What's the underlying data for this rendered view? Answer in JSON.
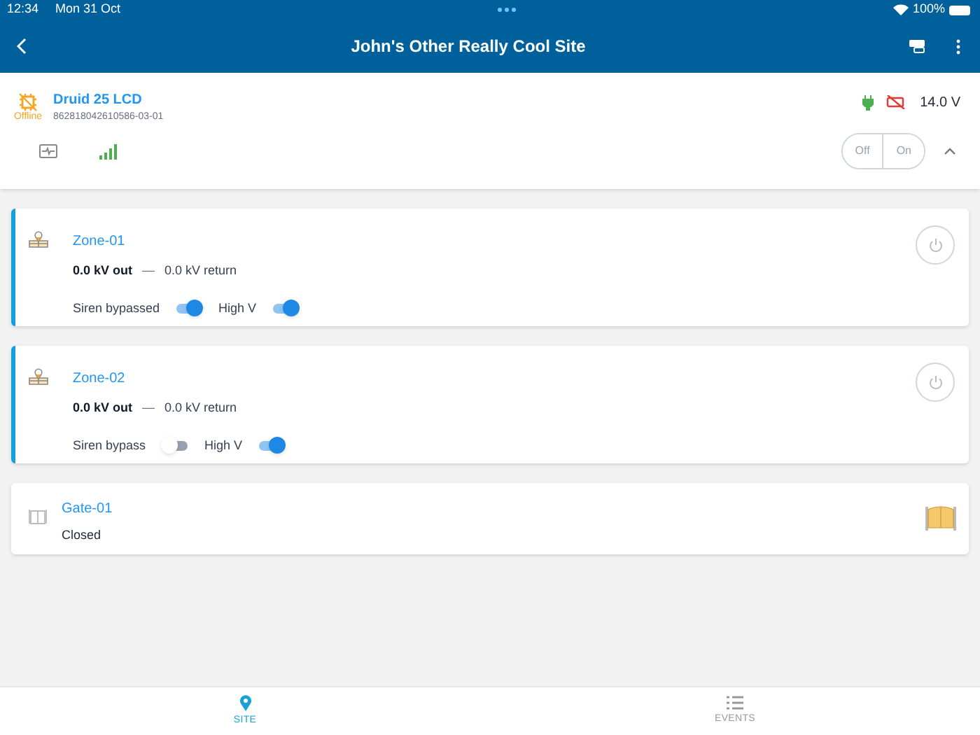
{
  "status_bar": {
    "time": "12:34",
    "date": "Mon 31 Oct",
    "battery": "100%"
  },
  "header": {
    "title": "John's Other Really Cool Site"
  },
  "device": {
    "name": "Druid 25 LCD",
    "serial": "862818042610586-03-01",
    "status": "Offline",
    "voltage": "14.0 V",
    "power_buttons": [
      "Off",
      "On"
    ]
  },
  "items": [
    {
      "kind": "zone",
      "name": "Zone-01",
      "out": "0.0 kV out",
      "separator": "—",
      "return": "0.0 kV return",
      "toggles": [
        {
          "label": "Siren bypassed",
          "on": true
        },
        {
          "label": "High V",
          "on": true
        }
      ]
    },
    {
      "kind": "zone",
      "name": "Zone-02",
      "out": "0.0 kV out",
      "separator": "—",
      "return": "0.0 kV return",
      "toggles": [
        {
          "label": "Siren bypass",
          "on": false
        },
        {
          "label": "High V",
          "on": true
        }
      ]
    },
    {
      "kind": "gate",
      "name": "Gate-01",
      "state": "Closed"
    }
  ],
  "tabs": [
    {
      "label": "SITE",
      "kind": "site",
      "selected": true
    },
    {
      "label": "EVENTS",
      "kind": "events",
      "selected": false
    }
  ]
}
